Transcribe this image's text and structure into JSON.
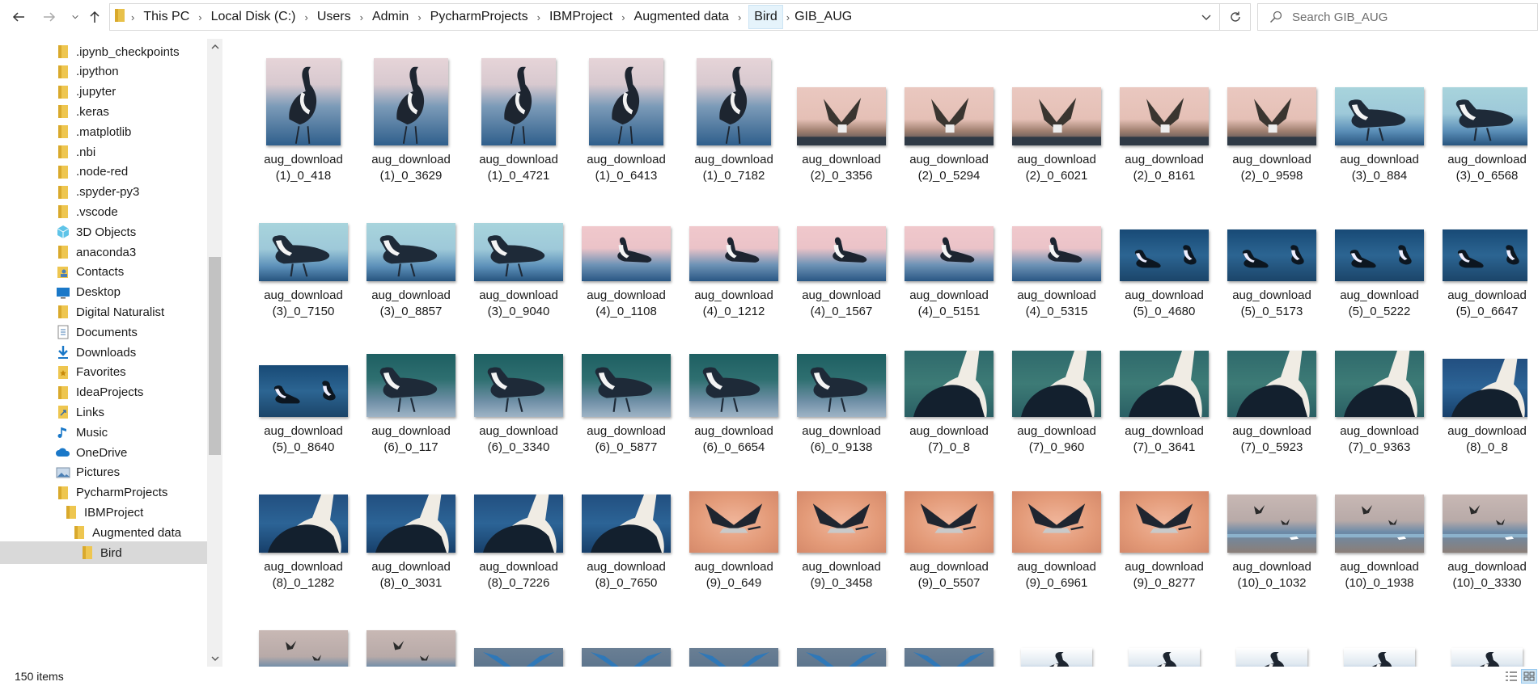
{
  "breadcrumb": [
    "This PC",
    "Local Disk (C:)",
    "Users",
    "Admin",
    "PycharmProjects",
    "IBMProject",
    "Augmented data",
    "Bird",
    "GIB_AUG"
  ],
  "search": {
    "placeholder": "Search GIB_AUG"
  },
  "sidebar": {
    "items": [
      {
        "label": ".ipynb_checkpoints",
        "icon": "folder-icon",
        "indent": 0
      },
      {
        "label": ".ipython",
        "icon": "folder-icon",
        "indent": 0
      },
      {
        "label": ".jupyter",
        "icon": "folder-icon",
        "indent": 0
      },
      {
        "label": ".keras",
        "icon": "folder-icon",
        "indent": 0
      },
      {
        "label": ".matplotlib",
        "icon": "folder-icon",
        "indent": 0
      },
      {
        "label": ".nbi",
        "icon": "folder-icon",
        "indent": 0
      },
      {
        "label": ".node-red",
        "icon": "folder-icon",
        "indent": 0
      },
      {
        "label": ".spyder-py3",
        "icon": "folder-icon",
        "indent": 0
      },
      {
        "label": ".vscode",
        "icon": "folder-icon",
        "indent": 0
      },
      {
        "label": "3D Objects",
        "icon": "3d-objects-icon",
        "indent": 0
      },
      {
        "label": "anaconda3",
        "icon": "folder-icon",
        "indent": 0
      },
      {
        "label": "Contacts",
        "icon": "contacts-icon",
        "indent": 0
      },
      {
        "label": "Desktop",
        "icon": "desktop-icon",
        "indent": 0
      },
      {
        "label": "Digital Naturalist",
        "icon": "folder-icon",
        "indent": 0
      },
      {
        "label": "Documents",
        "icon": "documents-icon",
        "indent": 0
      },
      {
        "label": "Downloads",
        "icon": "downloads-icon",
        "indent": 0
      },
      {
        "label": "Favorites",
        "icon": "favorites-icon",
        "indent": 0
      },
      {
        "label": "IdeaProjects",
        "icon": "folder-icon",
        "indent": 0
      },
      {
        "label": "Links",
        "icon": "links-icon",
        "indent": 0
      },
      {
        "label": "Music",
        "icon": "music-icon",
        "indent": 0
      },
      {
        "label": "OneDrive",
        "icon": "onedrive-icon",
        "indent": 0
      },
      {
        "label": "Pictures",
        "icon": "pictures-icon",
        "indent": 0
      },
      {
        "label": "PycharmProjects",
        "icon": "folder-icon",
        "indent": 0
      },
      {
        "label": "IBMProject",
        "icon": "folder-icon",
        "indent": 1
      },
      {
        "label": "Augmented data",
        "icon": "folder-icon",
        "indent": 2
      },
      {
        "label": "Bird",
        "icon": "folder-icon",
        "indent": 3,
        "selected": true
      }
    ]
  },
  "files": [
    {
      "l1": "aug_download",
      "l2": "(1)_0_418",
      "style": "a"
    },
    {
      "l1": "aug_download",
      "l2": "(1)_0_3629",
      "style": "a"
    },
    {
      "l1": "aug_download",
      "l2": "(1)_0_4721",
      "style": "a"
    },
    {
      "l1": "aug_download",
      "l2": "(1)_0_6413",
      "style": "a"
    },
    {
      "l1": "aug_download",
      "l2": "(1)_0_7182",
      "style": "a"
    },
    {
      "l1": "aug_download",
      "l2": "(2)_0_3356",
      "style": "b"
    },
    {
      "l1": "aug_download",
      "l2": "(2)_0_5294",
      "style": "b"
    },
    {
      "l1": "aug_download",
      "l2": "(2)_0_6021",
      "style": "b"
    },
    {
      "l1": "aug_download",
      "l2": "(2)_0_8161",
      "style": "b"
    },
    {
      "l1": "aug_download",
      "l2": "(2)_0_9598",
      "style": "b"
    },
    {
      "l1": "aug_download",
      "l2": "(3)_0_884",
      "style": "c"
    },
    {
      "l1": "aug_download",
      "l2": "(3)_0_6568",
      "style": "c"
    },
    {
      "l1": "aug_download",
      "l2": "(3)_0_7150",
      "style": "c"
    },
    {
      "l1": "aug_download",
      "l2": "(3)_0_8857",
      "style": "c"
    },
    {
      "l1": "aug_download",
      "l2": "(3)_0_9040",
      "style": "c"
    },
    {
      "l1": "aug_download",
      "l2": "(4)_0_1108",
      "style": "d"
    },
    {
      "l1": "aug_download",
      "l2": "(4)_0_1212",
      "style": "d"
    },
    {
      "l1": "aug_download",
      "l2": "(4)_0_1567",
      "style": "d"
    },
    {
      "l1": "aug_download",
      "l2": "(4)_0_5151",
      "style": "d"
    },
    {
      "l1": "aug_download",
      "l2": "(4)_0_5315",
      "style": "d"
    },
    {
      "l1": "aug_download",
      "l2": "(5)_0_4680",
      "style": "e"
    },
    {
      "l1": "aug_download",
      "l2": "(5)_0_5173",
      "style": "e"
    },
    {
      "l1": "aug_download",
      "l2": "(5)_0_5222",
      "style": "e"
    },
    {
      "l1": "aug_download",
      "l2": "(5)_0_6647",
      "style": "e"
    },
    {
      "l1": "aug_download",
      "l2": "(5)_0_8640",
      "style": "e"
    },
    {
      "l1": "aug_download",
      "l2": "(6)_0_117",
      "style": "f"
    },
    {
      "l1": "aug_download",
      "l2": "(6)_0_3340",
      "style": "f"
    },
    {
      "l1": "aug_download",
      "l2": "(6)_0_5877",
      "style": "f"
    },
    {
      "l1": "aug_download",
      "l2": "(6)_0_6654",
      "style": "f"
    },
    {
      "l1": "aug_download",
      "l2": "(6)_0_9138",
      "style": "f"
    },
    {
      "l1": "aug_download",
      "l2": "(7)_0_8",
      "style": "g"
    },
    {
      "l1": "aug_download",
      "l2": "(7)_0_960",
      "style": "g"
    },
    {
      "l1": "aug_download",
      "l2": "(7)_0_3641",
      "style": "g"
    },
    {
      "l1": "aug_download",
      "l2": "(7)_0_5923",
      "style": "g"
    },
    {
      "l1": "aug_download",
      "l2": "(7)_0_9363",
      "style": "g"
    },
    {
      "l1": "aug_download",
      "l2": "(8)_0_8",
      "style": "h"
    },
    {
      "l1": "aug_download",
      "l2": "(8)_0_1282",
      "style": "h"
    },
    {
      "l1": "aug_download",
      "l2": "(8)_0_3031",
      "style": "h"
    },
    {
      "l1": "aug_download",
      "l2": "(8)_0_7226",
      "style": "h"
    },
    {
      "l1": "aug_download",
      "l2": "(8)_0_7650",
      "style": "h"
    },
    {
      "l1": "aug_download",
      "l2": "(9)_0_649",
      "style": "i"
    },
    {
      "l1": "aug_download",
      "l2": "(9)_0_3458",
      "style": "i"
    },
    {
      "l1": "aug_download",
      "l2": "(9)_0_5507",
      "style": "i"
    },
    {
      "l1": "aug_download",
      "l2": "(9)_0_6961",
      "style": "i"
    },
    {
      "l1": "aug_download",
      "l2": "(9)_0_8277",
      "style": "i"
    },
    {
      "l1": "aug_download",
      "l2": "(10)_0_1032",
      "style": "j"
    },
    {
      "l1": "aug_download",
      "l2": "(10)_0_1938",
      "style": "j"
    },
    {
      "l1": "aug_download",
      "l2": "(10)_0_3330",
      "style": "j"
    },
    {
      "l1": "",
      "l2": "",
      "style": "j"
    },
    {
      "l1": "",
      "l2": "",
      "style": "j"
    },
    {
      "l1": "",
      "l2": "",
      "style": "k"
    },
    {
      "l1": "",
      "l2": "",
      "style": "k"
    },
    {
      "l1": "",
      "l2": "",
      "style": "k"
    },
    {
      "l1": "",
      "l2": "",
      "style": "k"
    },
    {
      "l1": "",
      "l2": "",
      "style": "k"
    },
    {
      "l1": "",
      "l2": "",
      "style": "l"
    },
    {
      "l1": "",
      "l2": "",
      "style": "l"
    },
    {
      "l1": "",
      "l2": "",
      "style": "l"
    },
    {
      "l1": "",
      "l2": "",
      "style": "l"
    },
    {
      "l1": "",
      "l2": "",
      "style": "l"
    }
  ],
  "status": {
    "item_count": "150 items"
  }
}
